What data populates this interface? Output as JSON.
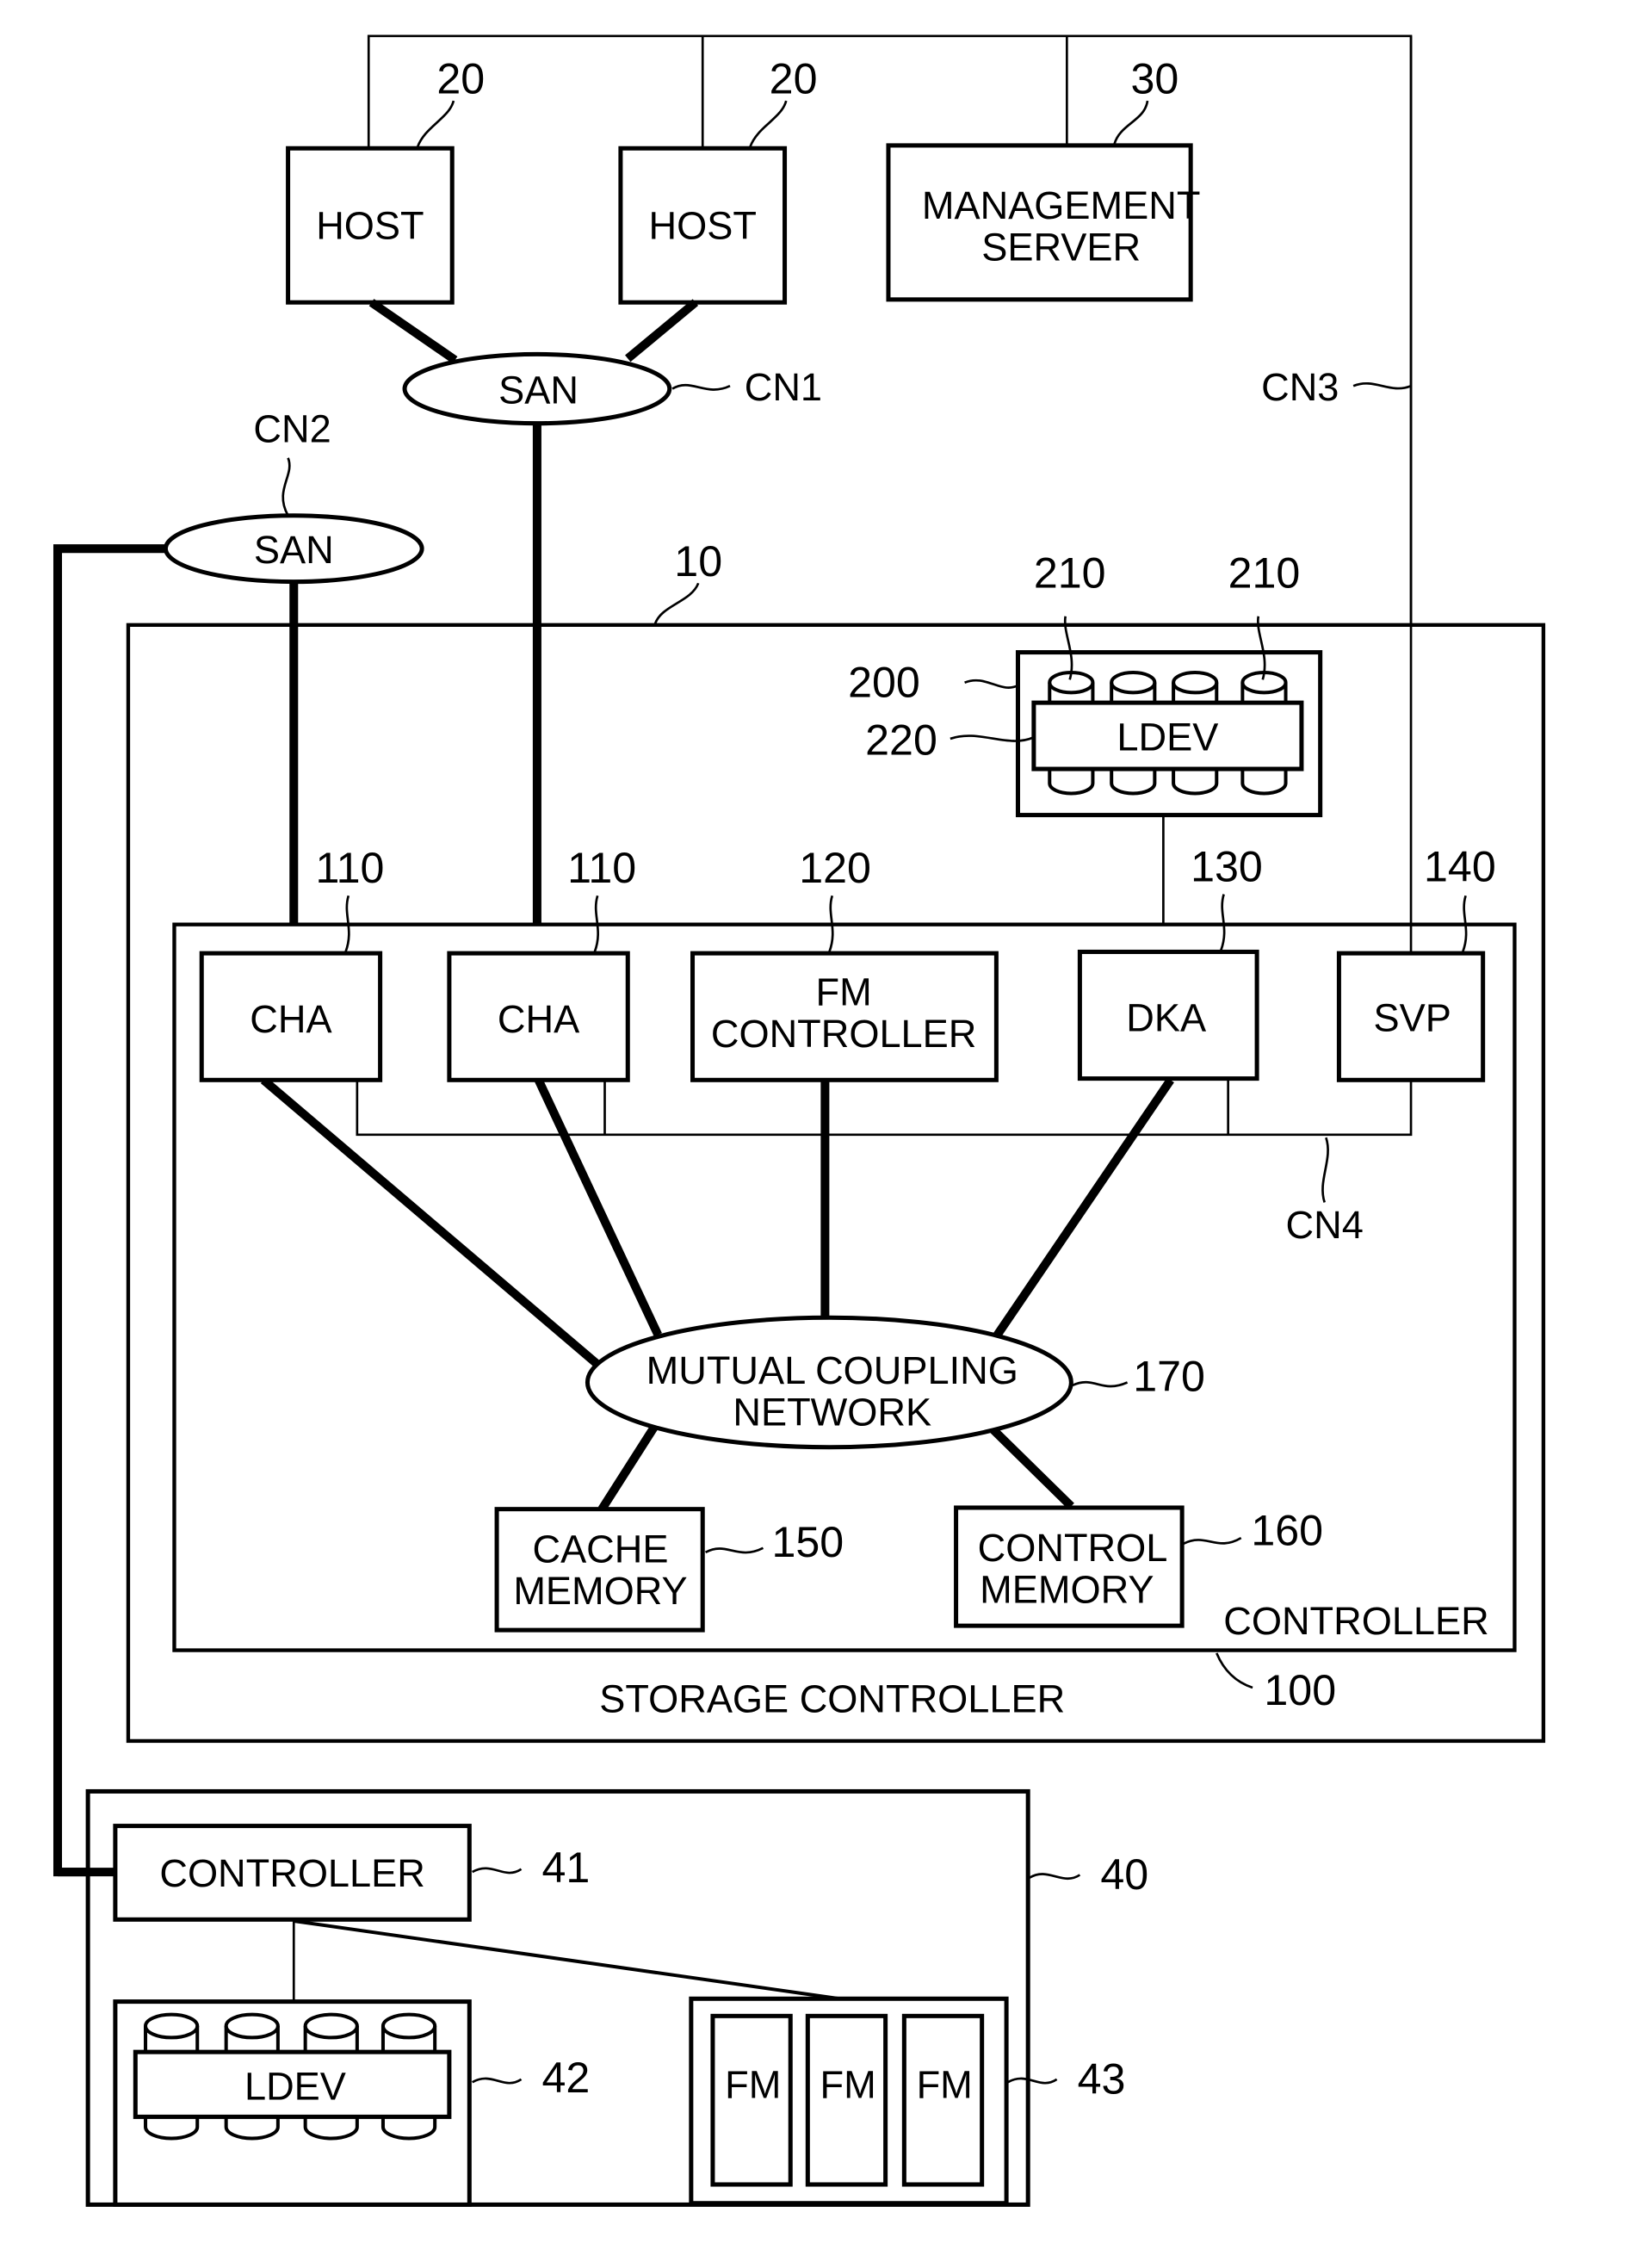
{
  "hosts": [
    {
      "label": "HOST",
      "ref": "20"
    },
    {
      "label": "HOST",
      "ref": "20"
    }
  ],
  "management_server": {
    "line1": "MANAGEMENT",
    "line2": "SERVER",
    "ref": "30"
  },
  "san1": {
    "label": "SAN",
    "ref": "CN1"
  },
  "san2": {
    "label": "SAN",
    "ref": "CN2"
  },
  "cn3": {
    "ref": "CN3"
  },
  "cn4": {
    "ref": "CN4"
  },
  "storage_system": {
    "ref": "10"
  },
  "disk_unit": {
    "ref": "200",
    "ldev_label": "LDEV",
    "ldev_ref": "220",
    "disk_ref_a": "210",
    "disk_ref_b": "210"
  },
  "controller": {
    "label": "CONTROLLER",
    "cha": [
      {
        "label": "CHA",
        "ref": "110"
      },
      {
        "label": "CHA",
        "ref": "110"
      }
    ],
    "fm_controller": {
      "line1": "FM",
      "line2": "CONTROLLER",
      "ref": "120"
    },
    "dka": {
      "label": "DKA",
      "ref": "130"
    },
    "svp": {
      "label": "SVP",
      "ref": "140"
    },
    "network": {
      "line1": "MUTUAL COUPLING",
      "line2": "NETWORK",
      "ref": "170"
    },
    "cache": {
      "line1": "CACHE",
      "line2": "MEMORY",
      "ref": "150"
    },
    "control_memory": {
      "line1": "CONTROL",
      "line2": "MEMORY",
      "ref": "160"
    }
  },
  "storage_controller": {
    "label": "STORAGE CONTROLLER",
    "ref": "100"
  },
  "external": {
    "ref": "40",
    "controller": {
      "label": "CONTROLLER",
      "ref": "41"
    },
    "ldev_group": {
      "label": "LDEV",
      "ref": "42"
    },
    "fm_group": {
      "labels": [
        "FM",
        "FM",
        "FM"
      ],
      "ref": "43"
    }
  }
}
